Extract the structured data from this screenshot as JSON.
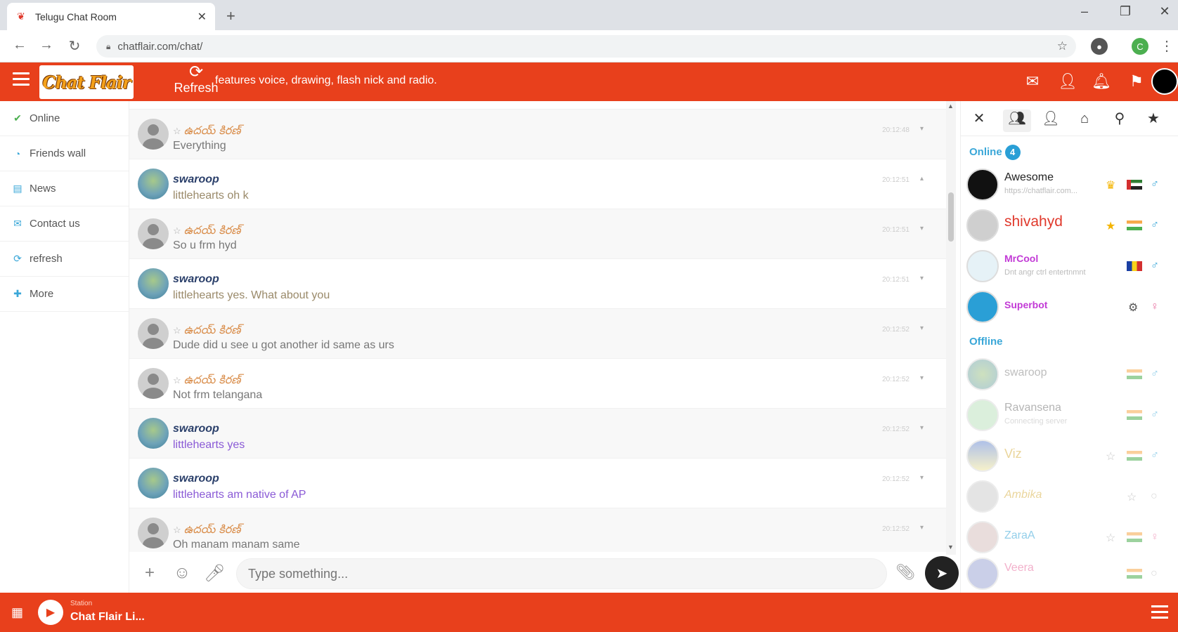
{
  "browser": {
    "tab_title": "Telugu Chat Room",
    "url": "chatflair.com/chat/"
  },
  "header": {
    "logo_text": "Chat Flair",
    "refresh_label": "Refresh",
    "ticker": "features voice, drawing, flash nick and radio."
  },
  "nav": {
    "items": [
      {
        "label": "Online",
        "icon": "check-circle-icon"
      },
      {
        "label": "Friends wall",
        "icon": "rss-icon"
      },
      {
        "label": "News",
        "icon": "newspaper-icon"
      },
      {
        "label": "Contact us",
        "icon": "envelope-icon"
      },
      {
        "label": "refresh",
        "icon": "refresh-icon"
      },
      {
        "label": "More",
        "icon": "plus-icon"
      }
    ]
  },
  "messages": [
    {
      "name": "ఉదయ్ కిరణ్",
      "text": "Everything",
      "time": "20:12:48",
      "type": "amber"
    },
    {
      "name": "swaroop",
      "text": "littlehearts oh k",
      "time": "20:12:51",
      "type": "swaroop"
    },
    {
      "name": "ఉదయ్ కిరణ్",
      "text": "So u frm hyd",
      "time": "20:12:51",
      "type": "amber"
    },
    {
      "name": "swaroop",
      "text": "littlehearts yes. What about you",
      "time": "20:12:51",
      "type": "swaroop"
    },
    {
      "name": "ఉదయ్ కిరణ్",
      "text": "Dude did u see u got another id same as urs",
      "time": "20:12:52",
      "type": "amber"
    },
    {
      "name": "ఉదయ్ కిరణ్",
      "text": "Not frm telangana",
      "time": "20:12:52",
      "type": "amber"
    },
    {
      "name": "swaroop",
      "text": "littlehearts yes",
      "time": "20:12:52",
      "type": "swaroop"
    },
    {
      "name": "swaroop",
      "text": "littlehearts am native of AP",
      "time": "20:12:52",
      "type": "swaroop"
    },
    {
      "name": "ఉదయ్ కిరణ్",
      "text": "Oh manam manam same",
      "time": "20:12:52",
      "type": "amber"
    }
  ],
  "composer": {
    "placeholder": "Type something..."
  },
  "panel": {
    "online_label": "Online",
    "online_count": "4",
    "offline_label": "Offline",
    "online_users": [
      {
        "name": "Awesome",
        "status": "https://chatflair.com...",
        "color": "#222222",
        "flag": "ae",
        "badge": "crown"
      },
      {
        "name": "shivahyd",
        "status": "",
        "color": "#e0392c",
        "flag": "in",
        "badge": "star"
      },
      {
        "name": "MrCool",
        "status": "Dnt angr ctrl entertnmnt",
        "color": "#c23ad6",
        "flag": "ro",
        "badge": ""
      },
      {
        "name": "Superbot",
        "status": "",
        "color": "#c23ad6",
        "flag": "",
        "badge": "bot"
      }
    ],
    "offline_users": [
      {
        "name": "swaroop",
        "status": "",
        "flag": "in"
      },
      {
        "name": "Ravansena",
        "status": "Connecting server",
        "flag": "in"
      },
      {
        "name": "Viz",
        "status": "",
        "flag": "in"
      },
      {
        "name": "Ambika",
        "status": "",
        "flag": ""
      },
      {
        "name": "ZaraA",
        "status": "",
        "flag": "in"
      },
      {
        "name": "Veera",
        "status": "",
        "flag": "in"
      }
    ]
  },
  "footer": {
    "station_label": "Station",
    "station_name": "Chat Flair Li..."
  },
  "colors": {
    "brand": "#e8401c",
    "online_accent": "#3aa7d8"
  }
}
